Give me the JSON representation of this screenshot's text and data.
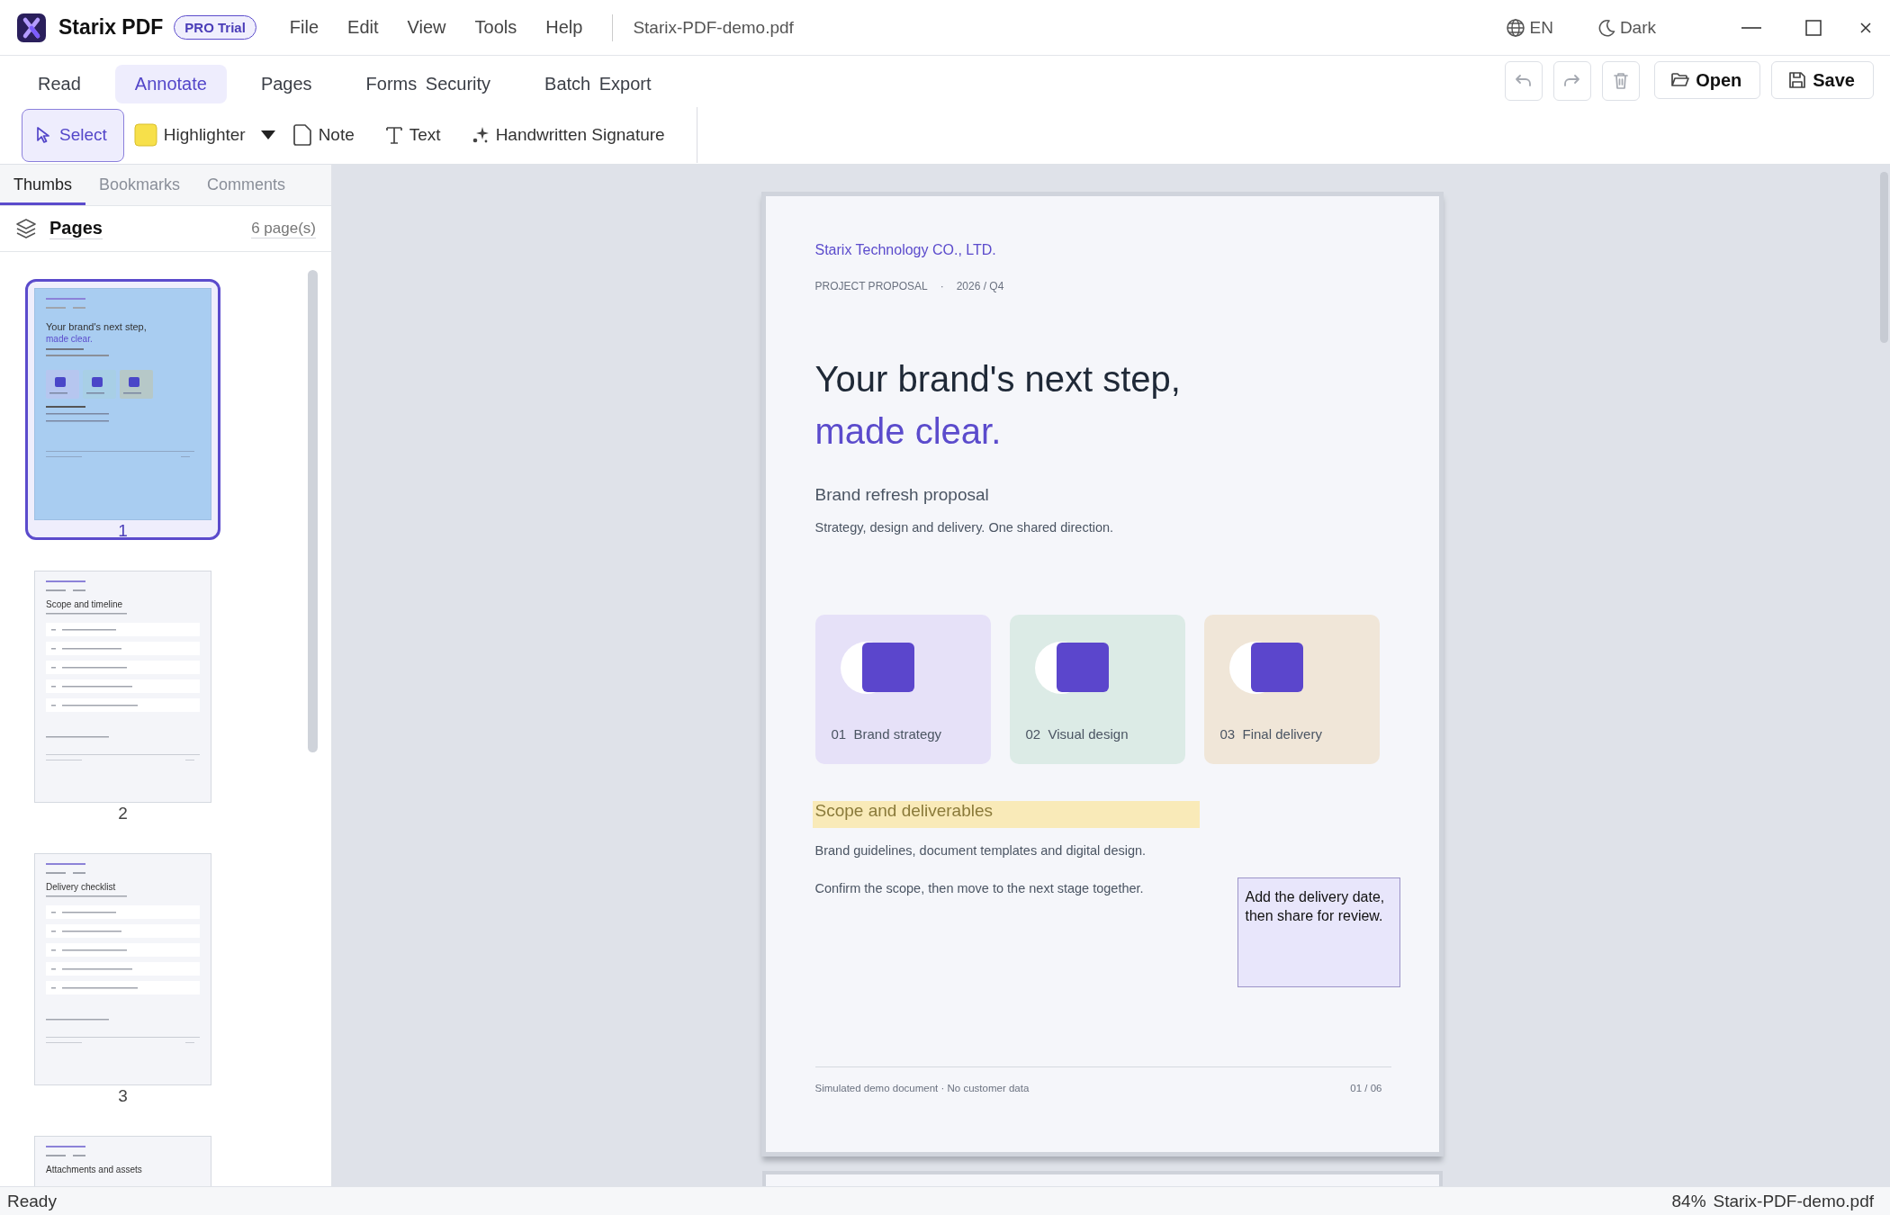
{
  "app": {
    "name": "Starix PDF",
    "badge": "PRO Trial"
  },
  "menu": [
    "File",
    "Edit",
    "View",
    "Tools",
    "Help"
  ],
  "document_name": "Starix-PDF-demo.pdf",
  "language": "EN",
  "theme_toggle": "Dark",
  "ribbon_tabs": [
    {
      "label": "Read",
      "selected": false
    },
    {
      "label": "Annotate",
      "selected": true
    },
    {
      "label": "Pages",
      "selected": false
    },
    {
      "label": "Forms Security",
      "selected": false
    },
    {
      "label": "Batch Export",
      "selected": false
    }
  ],
  "tools": [
    {
      "kind": "select",
      "label": "Select",
      "selected": true
    },
    {
      "kind": "highlighter",
      "label": "Highlighter",
      "selected": false
    },
    {
      "kind": "note",
      "label": "Note",
      "selected": false
    },
    {
      "kind": "text",
      "label": "Text",
      "selected": false
    },
    {
      "kind": "signature",
      "label": "Handwritten Signature",
      "selected": false
    }
  ],
  "history_buttons": [
    {
      "kind": "undo",
      "disabled": true
    },
    {
      "kind": "redo",
      "disabled": true
    },
    {
      "kind": "delete",
      "disabled": true
    }
  ],
  "file_buttons": [
    {
      "kind": "open",
      "label": "Open"
    },
    {
      "kind": "save",
      "label": "Save"
    }
  ],
  "sidebar": {
    "tabs": [
      {
        "label": "Thumbs",
        "selected": true
      },
      {
        "label": "Bookmarks",
        "selected": false
      },
      {
        "label": "Comments",
        "selected": false
      }
    ],
    "header": "Pages",
    "count": "6 page(s)",
    "thumbnails": [
      {
        "kind": "cover",
        "label": "1",
        "title": "Your brand's next step,",
        "accent": "made clear.",
        "selected": true
      },
      {
        "kind": "list",
        "label": "2",
        "title": "Scope and timeline",
        "selected": false
      },
      {
        "kind": "list",
        "label": "3",
        "title": "Delivery checklist",
        "selected": false
      },
      {
        "kind": "list",
        "title": "Attachments and assets",
        "selected": false
      }
    ]
  },
  "document": {
    "company": "Starix Technology CO., LTD.",
    "meta": [
      "PROJECT PROPOSAL",
      "·",
      "2026 / Q4"
    ],
    "headline": "Your brand's next step,",
    "headline_accent": "made clear.",
    "subtitle": "Brand refresh proposal",
    "lead": "Strategy, design and delivery. One shared direction.",
    "cards": [
      {
        "number": "01",
        "label": "Brand strategy",
        "color": "#e6e1f8"
      },
      {
        "number": "02",
        "label": "Visual design",
        "color": "#dcebe6"
      },
      {
        "number": "03",
        "label": "Final delivery",
        "color": "#f0e6d8"
      }
    ],
    "highlighted_heading": "Scope and deliverables",
    "paragraphs": [
      "Brand guidelines, document templates and digital design.",
      "Confirm the scope, then move to the next stage together."
    ],
    "sticky_note": "Add the delivery date, then share for review.",
    "footer": "Simulated demo document · No customer data",
    "page_number": "01 / 06"
  },
  "status_bar": {
    "status": "Ready",
    "zoom": "84%",
    "file": "Starix-PDF-demo.pdf"
  }
}
